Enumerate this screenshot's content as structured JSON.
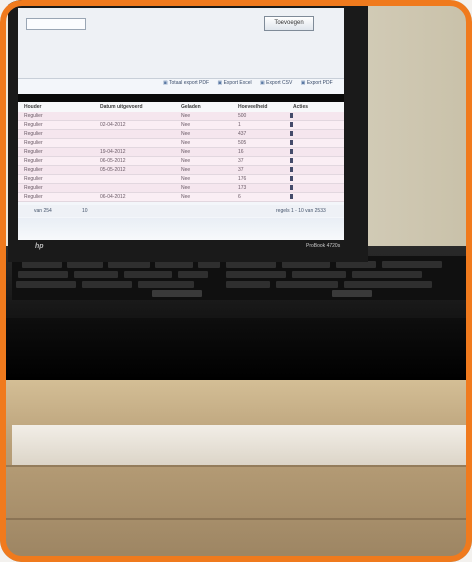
{
  "screen": {
    "button_label": "Toevoegen",
    "export_links": [
      "Totaal export PDF",
      "Export Excel",
      "Export CSV",
      "Export PDF"
    ],
    "columns": [
      "Houder",
      "Datum uitgevoerd",
      "Geladen",
      "Hoeveelheid",
      "Acties"
    ],
    "rows": [
      {
        "c1": "Regulier",
        "c2": "",
        "c3": "Nee",
        "c4": "500"
      },
      {
        "c1": "Regulier",
        "c2": "02-04-2012",
        "c3": "Nee",
        "c4": "1"
      },
      {
        "c1": "Regulier",
        "c2": "",
        "c3": "Nee",
        "c4": "437"
      },
      {
        "c1": "Regulier",
        "c2": "",
        "c3": "Nee",
        "c4": "505"
      },
      {
        "c1": "Regulier",
        "c2": "19-04-2012",
        "c3": "Nee",
        "c4": "16"
      },
      {
        "c1": "Regulier",
        "c2": "06-05-2012",
        "c3": "Nee",
        "c4": "37"
      },
      {
        "c1": "Regulier",
        "c2": "05-05-2012",
        "c3": "Nee",
        "c4": "37"
      },
      {
        "c1": "Regulier",
        "c2": "",
        "c3": "Nee",
        "c4": "176"
      },
      {
        "c1": "Regulier",
        "c2": "",
        "c3": "Nee",
        "c4": "173"
      },
      {
        "c1": "Regulier",
        "c2": "06-04-2012",
        "c3": "Nee",
        "c4": "6"
      }
    ],
    "pager_left": "van 254",
    "pager_mid": "10",
    "pager_right": "regels 1 - 10 van 2533"
  },
  "laptop": {
    "brand_mark": "hp",
    "model_label": "ProBook 4720s"
  },
  "colors": {
    "border": "#f07a1d",
    "bezel": "#1a1a1a"
  }
}
